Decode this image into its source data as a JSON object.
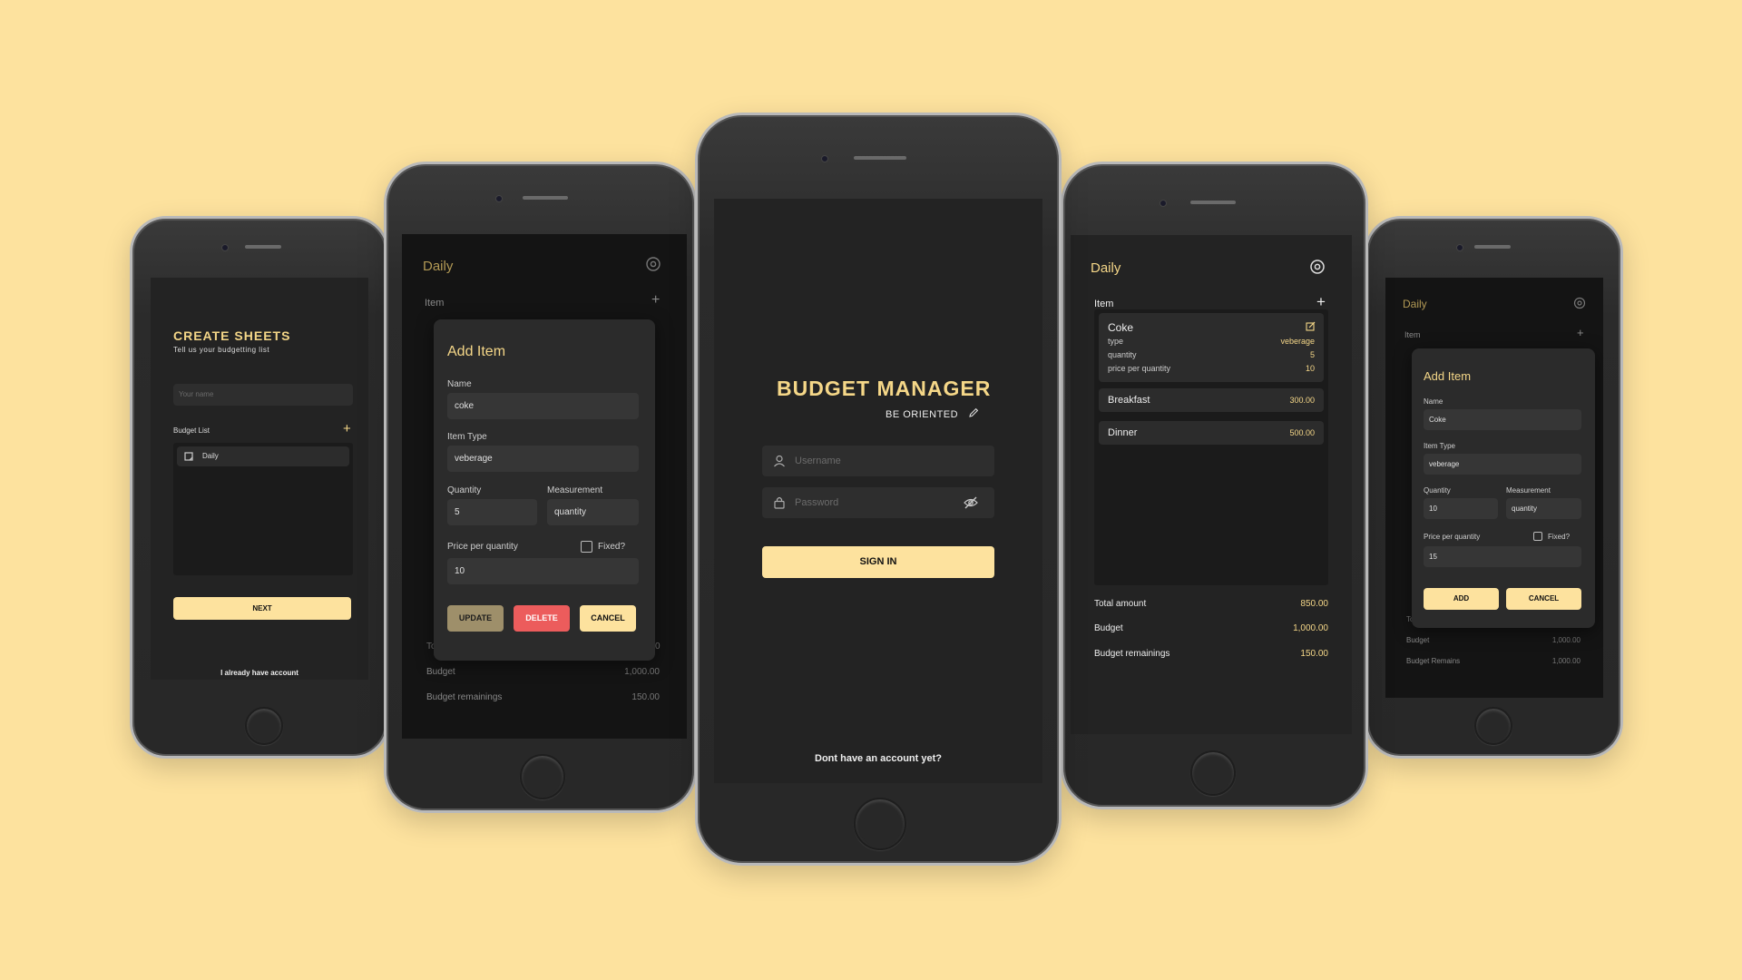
{
  "colors": {
    "background": "#fde29e",
    "screen": "#232323",
    "accent": "#f5d788",
    "danger": "#ec5c5c"
  },
  "phone1": {
    "title": "CREATE SHEETS",
    "subtitle": "Tell us your budgetting list",
    "name_placeholder": "Your name",
    "list_label": "Budget List",
    "list_item": "Daily",
    "next_button": "NEXT",
    "footer_link": "I already have account"
  },
  "phone2": {
    "header_title": "Daily",
    "item_label": "Item",
    "dialog_title": "Add Item",
    "name_label": "Name",
    "name_value": "coke",
    "type_label": "Item Type",
    "type_value": "veberage",
    "quantity_label": "Quantity",
    "quantity_value": "5",
    "measurement_label": "Measurement",
    "measurement_value": "quantity",
    "price_label": "Price per quantity",
    "fixed_label": "Fixed?",
    "price_value": "10",
    "update_button": "UPDATE",
    "delete_button": "DELETE",
    "cancel_button": "CANCEL",
    "total_label_partial": "To",
    "total_value_partial": "0",
    "budget_label": "Budget",
    "budget_value": "1,000.00",
    "remain_label": "Budget remainings",
    "remain_value": "150.00"
  },
  "phone3": {
    "app_title": "BUDGET MANAGER",
    "tagline": "BE ORIENTED",
    "username_placeholder": "Username",
    "password_placeholder": "Password",
    "signin_button": "SIGN IN",
    "footer_link": "Dont have an account yet?"
  },
  "phone4": {
    "header_title": "Daily",
    "item_label": "Item",
    "items": [
      {
        "name": "Coke",
        "details": [
          {
            "k": "type",
            "v": "veberage"
          },
          {
            "k": "quantity",
            "v": "5"
          },
          {
            "k": "price per quantity",
            "v": "10"
          }
        ]
      },
      {
        "name": "Breakfast",
        "amount": "300.00"
      },
      {
        "name": "Dinner",
        "amount": "500.00"
      }
    ],
    "total_label": "Total amount",
    "total_value": "850.00",
    "budget_label": "Budget",
    "budget_value": "1,000.00",
    "remain_label": "Budget remainings",
    "remain_value": "150.00"
  },
  "phone5": {
    "header_title": "Daily",
    "item_label": "Item",
    "dialog_title": "Add Item",
    "name_label": "Name",
    "name_value": "Coke",
    "type_label": "Item Type",
    "type_value": "veberage",
    "quantity_label": "Quantity",
    "quantity_value": "10",
    "measurement_label": "Measurement",
    "measurement_value": "quantity",
    "price_label": "Price per quantity",
    "fixed_label": "Fixed?",
    "price_value": "15",
    "add_button": "ADD",
    "cancel_button": "CANCEL",
    "total_label_partial": "To",
    "total_value_partial": "0",
    "budget_label": "Budget",
    "budget_value": "1,000.00",
    "remain_label": "Budget Remains",
    "remain_value": "1,000.00"
  }
}
